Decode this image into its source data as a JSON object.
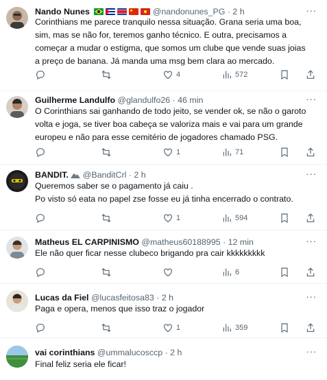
{
  "tweets": [
    {
      "name": "Nando Nunes",
      "handle": "@nandonunes_PG",
      "sep": "·",
      "time": "2 h",
      "flags": [
        "brazil",
        "cuba",
        "north-korea",
        "china",
        "vietnam"
      ],
      "text": "Corinthians me parece tranquilo nessa situação. Grana seria uma boa, sim, mas se não for, teremos ganho técnico. E outra, precisamos a começar a mudar o estigma, que somos um clube que vende suas joias a preço de banana. Já manda uma msg bem clara ao mercado.",
      "replies": "",
      "retweets": "",
      "likes": "4",
      "views": "572"
    },
    {
      "name": "Guilherme Landulfo",
      "handle": "@glandulfo26",
      "sep": "·",
      "time": "46 min",
      "text": "O Corinthians sai ganhando de todo jeito, se vender ok, se não o garoto volta e joga, se tiver boa cabeça se valoriza mais e vai para um grande europeu e não para esse cemitério de jogadores chamado PSG.",
      "replies": "",
      "retweets": "",
      "likes": "1",
      "views": "71"
    },
    {
      "name": "BANDIT.",
      "handle": "@BanditCrl",
      "sep": "·",
      "time": "2 h",
      "text": "Queremos saber se o pagamento já caiu .\nPo visto só eata no papel zse fosse eu já tinha encerrado o contrato.",
      "replies": "",
      "retweets": "",
      "likes": "1",
      "views": "594"
    },
    {
      "name": "Matheus EL CARPINISMO",
      "handle": "@matheus60188995",
      "sep": "·",
      "time": "12 min",
      "text": "Ele não quer ficar nesse clubeco brigando pra cair kkkkkkkkk",
      "replies": "",
      "retweets": "",
      "likes": "",
      "views": "6"
    },
    {
      "name": "Lucas da Fiel",
      "handle": "@lucasfeitosa83",
      "sep": "·",
      "time": "2 h",
      "text": "Paga e opera, menos que isso traz o jogador",
      "replies": "",
      "retweets": "",
      "likes": "1",
      "views": "359"
    },
    {
      "name": "vai corinthians",
      "handle": "@ummalucosccp",
      "sep": "·",
      "time": "2 h",
      "text": "Final feliz seria ele ficar!",
      "replies": "",
      "retweets": "",
      "likes": "",
      "views": ""
    }
  ],
  "icons": {
    "more": "more-icon",
    "reply": "reply-icon",
    "retweet": "retweet-icon",
    "like": "heart-icon",
    "views": "views-icon",
    "bookmark": "bookmark-icon",
    "share": "share-icon"
  },
  "colors": {
    "text": "#0f1419",
    "secondary": "#536471",
    "divider": "#eff3f4"
  }
}
